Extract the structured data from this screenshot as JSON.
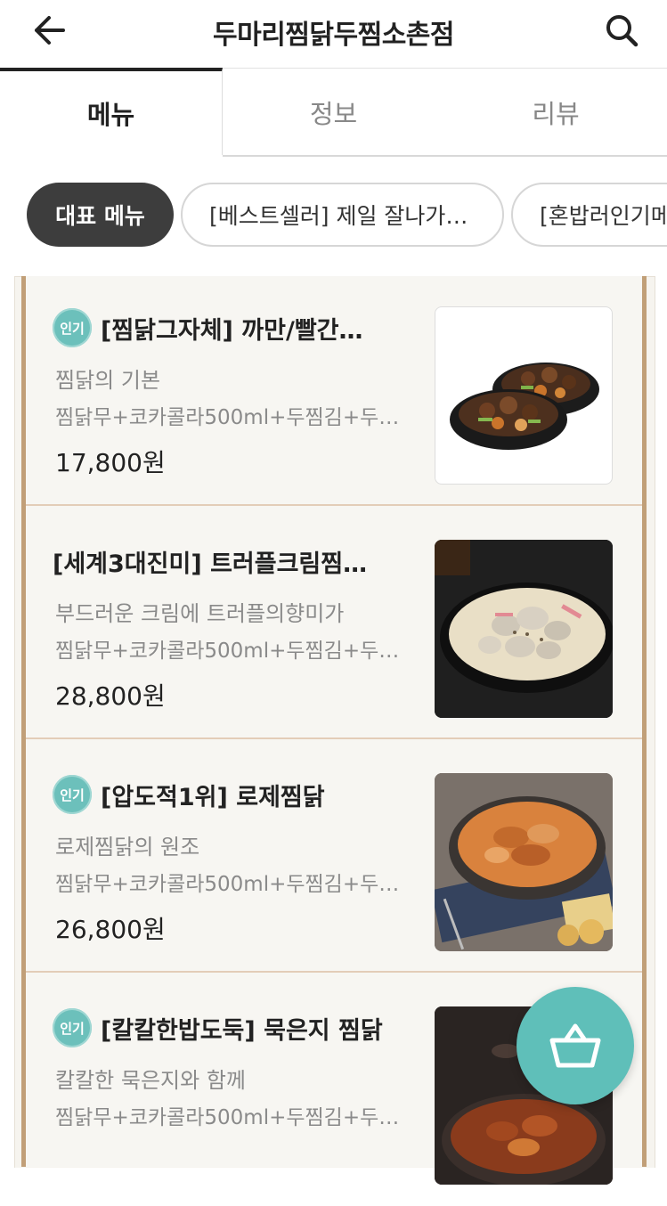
{
  "header": {
    "title": "두마리찜닭두찜소촌점",
    "back_icon": "arrow-left-icon",
    "search_icon": "search-icon"
  },
  "tabs": [
    {
      "label": "메뉴",
      "active": true
    },
    {
      "label": "정보",
      "active": false
    },
    {
      "label": "리뷰",
      "active": false
    }
  ],
  "chips": [
    {
      "label": "대표 메뉴",
      "active": true
    },
    {
      "label": "[베스트셀러] 제일 잘나가…",
      "active": false
    },
    {
      "label": "[혼밥러인기메뉴",
      "active": false
    }
  ],
  "menu_items": [
    {
      "badge": "인기",
      "name": "[찜닭그자체] 까만/빨간…",
      "description": "찜닭의 기본",
      "includes": "찜닭무+코카콜라500ml+두찜김+두…",
      "price": "17,800원"
    },
    {
      "badge": "",
      "name": "[세계3대진미] 트러플크림찜…",
      "description": "부드러운 크림에 트러플의향미가",
      "includes": "찜닭무+코카콜라500ml+두찜김+두…",
      "price": "28,800원"
    },
    {
      "badge": "인기",
      "name": "[압도적1위] 로제찜닭",
      "description": "로제찜닭의 원조",
      "includes": "찜닭무+코카콜라500ml+두찜김+두…",
      "price": "26,800원"
    },
    {
      "badge": "인기",
      "name": "[칼칼한밥도둑] 묵은지 찜닭",
      "description": "칼칼한 묵은지와 함께",
      "includes": "찜닭무+코카콜라500ml+두찜김+두…",
      "price": ""
    }
  ],
  "cart": {
    "icon": "basket-icon"
  },
  "colors": {
    "accent": "#5fbfb9",
    "board_frame": "#c19f78",
    "active_chip": "#3d3d3d"
  }
}
